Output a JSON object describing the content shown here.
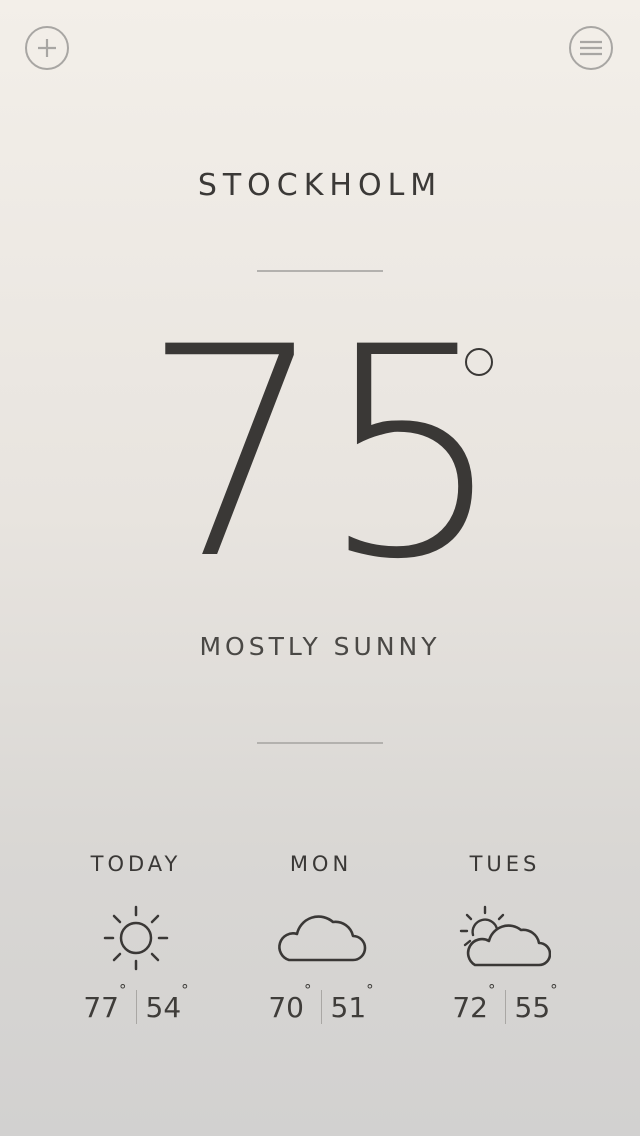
{
  "header": {
    "add_icon": "plus-icon",
    "menu_icon": "hamburger-menu-icon"
  },
  "current": {
    "city": "STOCKHOLM",
    "temperature": "75",
    "condition": "MOSTLY SUNNY"
  },
  "forecast": [
    {
      "label": "TODAY",
      "icon": "sun-icon",
      "high": "77",
      "low": "54"
    },
    {
      "label": "MON",
      "icon": "cloud-icon",
      "high": "70",
      "low": "51"
    },
    {
      "label": "TUES",
      "icon": "partly-cloudy-icon",
      "high": "72",
      "low": "55"
    }
  ],
  "colors": {
    "text": "#3a3836",
    "divider": "#b3b1ae",
    "icon_outline": "#a8a6a3"
  }
}
